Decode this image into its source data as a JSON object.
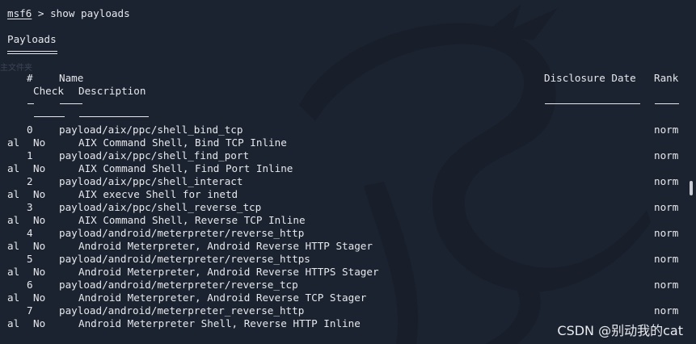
{
  "prompt": {
    "label": "msf6",
    "command": " > show payloads"
  },
  "section_title": "Payloads",
  "ghost_text": "主文件夹",
  "columns": {
    "num": "#",
    "name": "Name",
    "disclosure_date": "Disclosure Date",
    "rank": "Rank",
    "check": "Check",
    "description": "Description"
  },
  "rows": [
    {
      "num": "0",
      "name": "payload/aix/ppc/shell_bind_tcp",
      "rank_head": "norm",
      "rank_tail": "al",
      "check": "No",
      "description": "AIX Command Shell, Bind TCP Inline"
    },
    {
      "num": "1",
      "name": "payload/aix/ppc/shell_find_port",
      "rank_head": "norm",
      "rank_tail": "al",
      "check": "No",
      "description": "AIX Command Shell, Find Port Inline"
    },
    {
      "num": "2",
      "name": "payload/aix/ppc/shell_interact",
      "rank_head": "norm",
      "rank_tail": "al",
      "check": "No",
      "description": "AIX execve Shell for inetd"
    },
    {
      "num": "3",
      "name": "payload/aix/ppc/shell_reverse_tcp",
      "rank_head": "norm",
      "rank_tail": "al",
      "check": "No",
      "description": "AIX Command Shell, Reverse TCP Inline"
    },
    {
      "num": "4",
      "name": "payload/android/meterpreter/reverse_http",
      "rank_head": "norm",
      "rank_tail": "al",
      "check": "No",
      "description": "Android Meterpreter, Android Reverse HTTP Stager"
    },
    {
      "num": "5",
      "name": "payload/android/meterpreter/reverse_https",
      "rank_head": "norm",
      "rank_tail": "al",
      "check": "No",
      "description": "Android Meterpreter, Android Reverse HTTPS Stager"
    },
    {
      "num": "6",
      "name": "payload/android/meterpreter/reverse_tcp",
      "rank_head": "norm",
      "rank_tail": "al",
      "check": "No",
      "description": "Android Meterpreter, Android Reverse TCP Stager"
    },
    {
      "num": "7",
      "name": "payload/android/meterpreter_reverse_http",
      "rank_head": "norm",
      "rank_tail": "al",
      "check": "No",
      "description": "Android Meterpreter Shell, Reverse HTTP Inline"
    }
  ],
  "watermark": "CSDN @别动我的cat",
  "colors": {
    "background": "#1c2330",
    "text": "#e6e8ec",
    "art": "#0f141d"
  }
}
